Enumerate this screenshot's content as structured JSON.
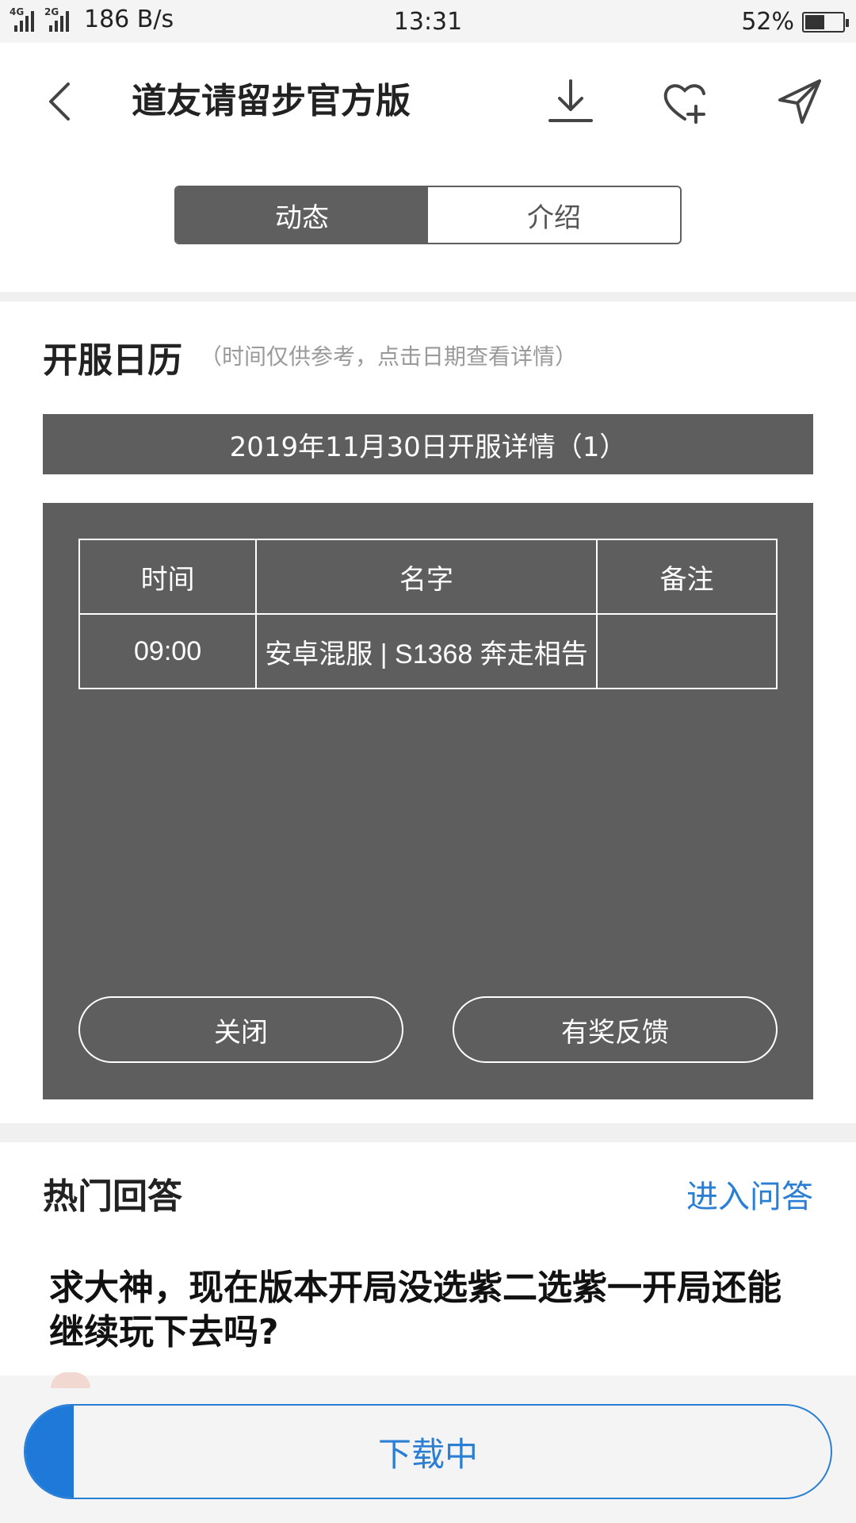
{
  "status_bar": {
    "network_1": "4G",
    "network_2": "2G",
    "speed": "186 B/s",
    "time": "13:31",
    "battery_percent": "52%",
    "battery_level": 0.52
  },
  "header": {
    "title": "道友请留步官方版",
    "icons": [
      "back-icon",
      "download-icon",
      "favorite-add-icon",
      "share-icon"
    ]
  },
  "tabs": [
    {
      "label": "动态",
      "active": true
    },
    {
      "label": "介绍",
      "active": false
    }
  ],
  "calendar": {
    "title": "开服日历",
    "hint": "（时间仅供参考，点击日期查看详情）",
    "date_heading": "2019年11月30日开服详情（1）",
    "columns": [
      "时间",
      "名字",
      "备注"
    ],
    "rows": [
      {
        "time": "09:00",
        "name": "安卓混服 | S1368 奔走相告",
        "note": ""
      }
    ],
    "close_label": "关闭",
    "feedback_label": "有奖反馈"
  },
  "hot_answers": {
    "title": "热门回答",
    "link": "进入问答",
    "question": "求大神，现在版本开局没选紫二选紫一开局还能继续玩下去吗?"
  },
  "download": {
    "label": "下载中",
    "progress": 0.06
  },
  "colors": {
    "panel": "#5e5e5e",
    "accent": "#2a7fd4",
    "progress": "#1e79d8"
  }
}
